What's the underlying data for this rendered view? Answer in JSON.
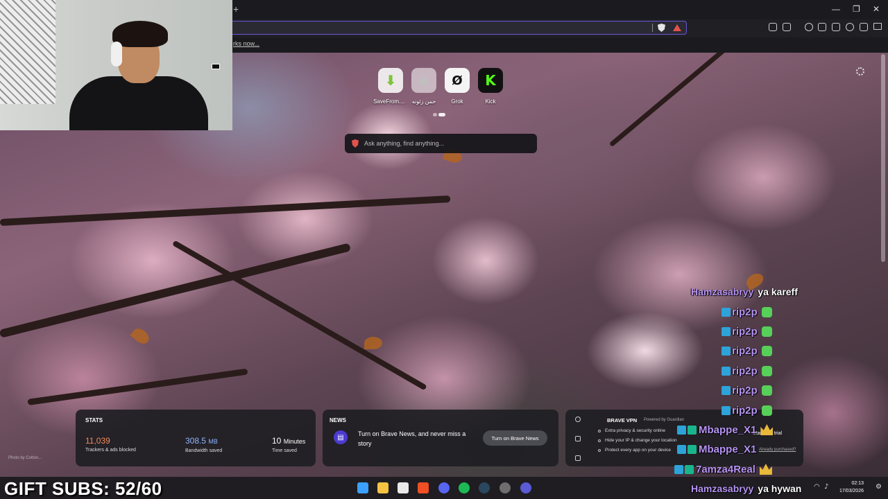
{
  "browser": {
    "new_tab_symbol": "+",
    "window_controls": {
      "minimize": "—",
      "restore": "❐",
      "close": "✕"
    },
    "bookmarks_link": "rks now..."
  },
  "new_tab_page": {
    "top_sites": [
      {
        "label": "SaveFrom....",
        "icon": "download-arrow-icon",
        "color": "#7cc43a"
      },
      {
        "label": "حمن زئونه",
        "icon": "site-placeholder-icon",
        "color": "#bfbfbf"
      },
      {
        "label": "Grok",
        "icon": "grok-icon",
        "color": "#111111"
      },
      {
        "label": "Kick",
        "icon": "kick-icon",
        "color": "#53fc18"
      }
    ],
    "search": {
      "placeholder": "Ask anything, find anything..."
    },
    "photo_credit": "Photo by Cotton..."
  },
  "widgets": {
    "stats": {
      "title": "STATS",
      "trackers_value": "11,039",
      "trackers_label": "Trackers & ads blocked",
      "bandwidth_value": "308.5",
      "bandwidth_unit": "MB",
      "bandwidth_label": "Bandwidth saved",
      "time_value": "10",
      "time_unit": "Minutes",
      "time_label": "Time saved"
    },
    "news": {
      "title": "NEWS",
      "text": "Turn on Brave News, and never miss a story",
      "button": "Turn on Brave News"
    },
    "vpn": {
      "title": "BRAVE VPN",
      "powered_by": "Powered by Guardian",
      "features": [
        "Extra privacy & security online",
        "Hide your IP & change your location",
        "Protect every app on your device"
      ],
      "trial_button": "Start free trial",
      "already_purchased": "Already purchased?"
    }
  },
  "chat": [
    {
      "user": "Hamzasabryy",
      "message": "ya kareff",
      "badges": 0,
      "emote": "none"
    },
    {
      "user": "rip2p",
      "message": "",
      "badges": 1,
      "emote": "green"
    },
    {
      "user": "rip2p",
      "message": "",
      "badges": 1,
      "emote": "green"
    },
    {
      "user": "rip2p",
      "message": "",
      "badges": 1,
      "emote": "green"
    },
    {
      "user": "rip2p",
      "message": "",
      "badges": 1,
      "emote": "green"
    },
    {
      "user": "rip2p",
      "message": "",
      "badges": 1,
      "emote": "green"
    },
    {
      "user": "rip2p",
      "message": "",
      "badges": 1,
      "emote": "green"
    },
    {
      "user": "Mbappe_X1",
      "message": "",
      "badges": 2,
      "emote": "crown"
    },
    {
      "user": "Mbappe_X1",
      "message": "",
      "badges": 2,
      "emote": "none"
    },
    {
      "user": "7amza4Real",
      "message": "",
      "badges": 2,
      "emote": "crown"
    },
    {
      "user": "Hamzasabryy",
      "message": "ya hywan",
      "badges": 0,
      "emote": "none"
    }
  ],
  "gift_subs": "GIFT SUBS: 52/60",
  "taskbar": {
    "apps": [
      {
        "name": "windows-start-icon",
        "color": "#3ba0ff"
      },
      {
        "name": "file-explorer-icon",
        "color": "#f6c342"
      },
      {
        "name": "store-icon",
        "color": "#e9e9e9"
      },
      {
        "name": "brave-browser-icon",
        "color": "#f04e23"
      },
      {
        "name": "discord-icon",
        "color": "#5865f2"
      },
      {
        "name": "spotify-icon",
        "color": "#1db954"
      },
      {
        "name": "steam-icon",
        "color": "#2a475e"
      },
      {
        "name": "obs-icon",
        "color": "#6e6e6e"
      },
      {
        "name": "app-ring-icon",
        "color": "#5b5bd6"
      }
    ],
    "time": "02:13",
    "date": "17/03/2026"
  },
  "colors": {
    "accent": "#6b56d6",
    "brave_orange": "#e2524c",
    "chat_username": "#b794f4"
  }
}
